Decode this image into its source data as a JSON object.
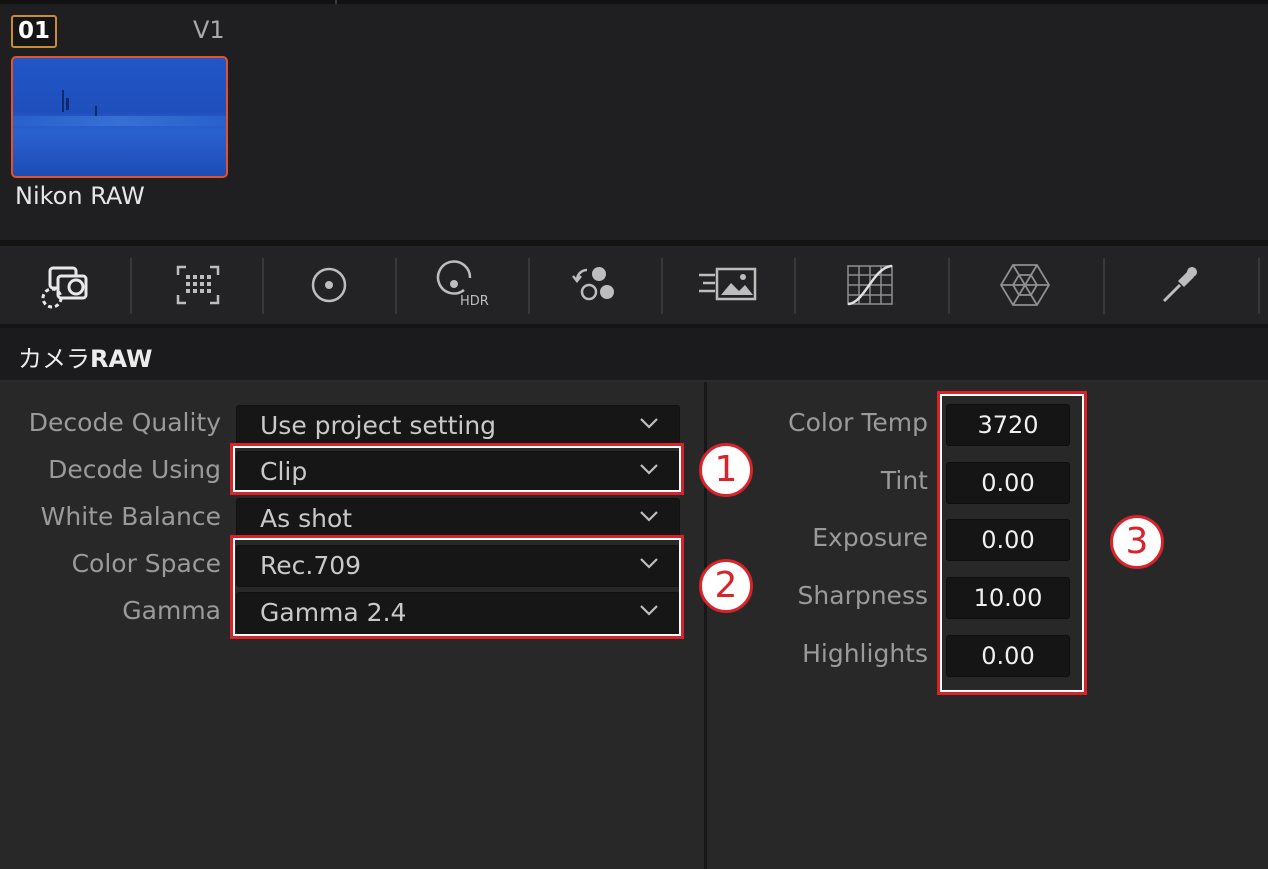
{
  "clip": {
    "number": "01",
    "track": "V1",
    "name": "Nikon RAW"
  },
  "toolbar": {
    "tools": [
      {
        "icon": "camera-raw-icon"
      },
      {
        "icon": "color-match-icon"
      },
      {
        "icon": "primaries-wheels-icon"
      },
      {
        "icon": "hdr-wheels-icon",
        "badge": "HDR"
      },
      {
        "icon": "rgb-mixer-icon"
      },
      {
        "icon": "motion-effects-icon"
      },
      {
        "icon": "curves-icon"
      },
      {
        "icon": "color-warper-icon"
      },
      {
        "icon": "qualifier-icon"
      }
    ]
  },
  "panel": {
    "title_kana": "カメラ",
    "title_latin": "RAW"
  },
  "decode": {
    "rows": [
      {
        "label": "Decode Quality",
        "value": "Use project setting"
      },
      {
        "label": "Decode Using",
        "value": "Clip"
      },
      {
        "label": "White Balance",
        "value": "As shot"
      },
      {
        "label": "Color Space",
        "value": "Rec.709"
      },
      {
        "label": "Gamma",
        "value": "Gamma 2.4"
      }
    ]
  },
  "adjust": {
    "rows": [
      {
        "label": "Color Temp",
        "value": "3720"
      },
      {
        "label": "Tint",
        "value": "0.00"
      },
      {
        "label": "Exposure",
        "value": "0.00"
      },
      {
        "label": "Sharpness",
        "value": "10.00"
      },
      {
        "label": "Highlights",
        "value": "0.00"
      }
    ]
  },
  "annotations": {
    "marker1": "1",
    "marker2": "2",
    "marker3": "3",
    "color": "#d8232a"
  },
  "colors": {
    "clip_selection": "#e0532c",
    "clip_number_border": "#c98a3a",
    "panel_bg": "#282829"
  }
}
